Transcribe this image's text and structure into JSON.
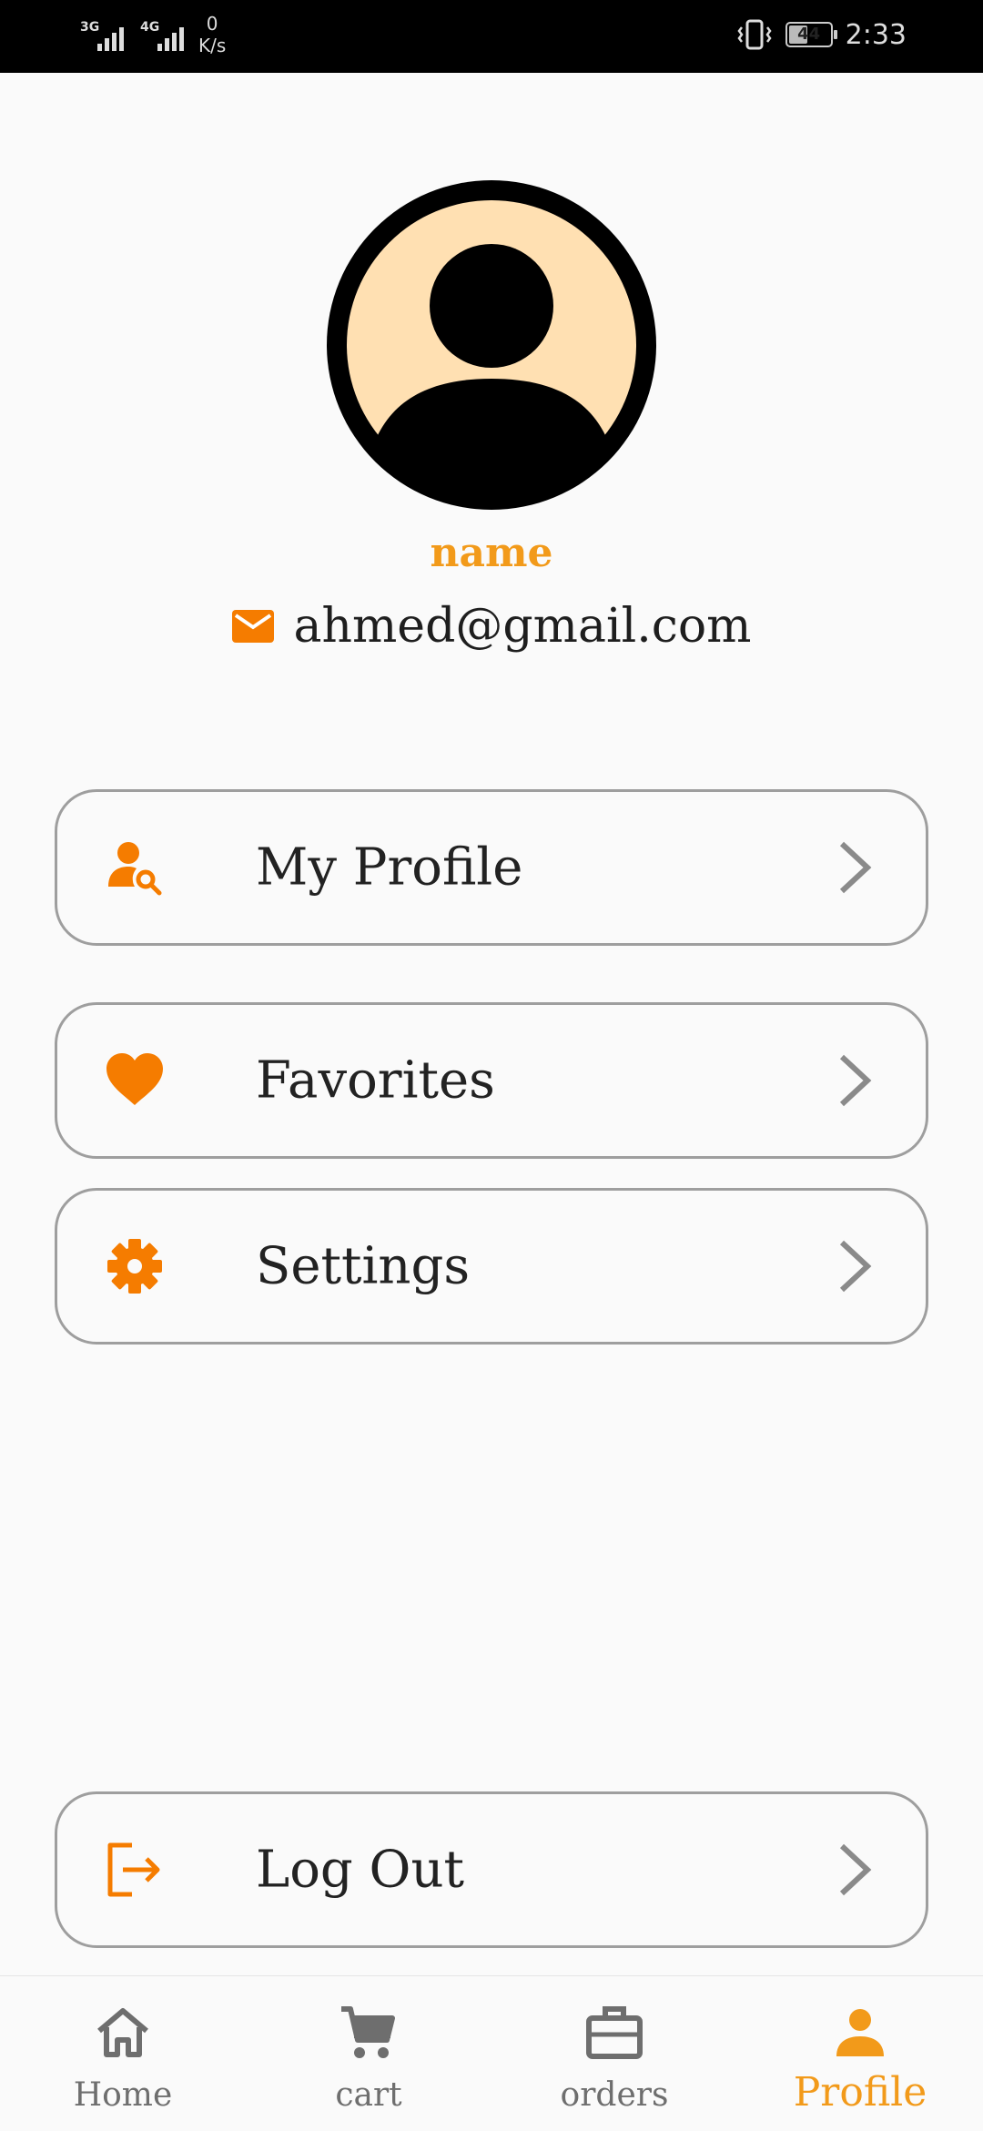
{
  "status_bar": {
    "signal1_label": "3G",
    "signal2_label": "4G",
    "net_speed_value": "0",
    "net_speed_unit": "K/s",
    "battery": "44",
    "time": "2:33"
  },
  "profile": {
    "name": "name",
    "email": "ahmed@gmail.com"
  },
  "menu": {
    "my_profile": "My Profile",
    "favorites": "Favorites",
    "settings": "Settings",
    "logout": "Log Out"
  },
  "bottom_nav": {
    "home": "Home",
    "cart": "cart",
    "orders": "orders",
    "profile": "Profile",
    "active": "profile"
  },
  "colors": {
    "accent": "#f29a1a",
    "icon_orange": "#f57c00",
    "avatar_bg": "#ffe0b2",
    "border": "#9e9e9e"
  },
  "icons": {
    "my_profile": "person-search-icon",
    "favorites": "heart-icon",
    "settings": "gear-icon",
    "logout": "logout-icon",
    "email": "mail-icon"
  }
}
